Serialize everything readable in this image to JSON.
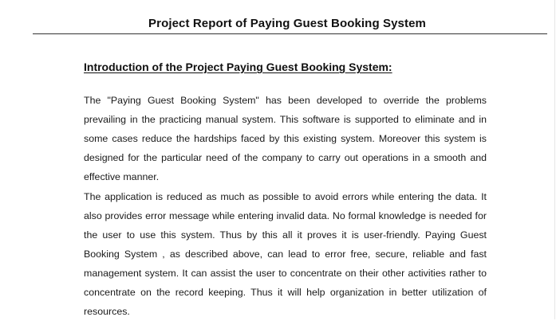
{
  "document": {
    "title": "Project Report of Paying Guest Booking System",
    "section_heading": "Introduction of the Project Paying Guest Booking System:",
    "paragraphs": [
      "The \"Paying Guest Booking System\" has been developed to override the problems prevailing in the practicing manual system. This software is supported to eliminate and in some cases reduce the hardships faced by this existing system. Moreover this system is designed for the particular need of the company to carry out operations in a smooth and effective manner.",
      "The application is reduced as much as possible to avoid errors while entering the data. It also provides error message while entering invalid data. No formal knowledge is needed for the user to use this system. Thus by this all it proves it is user-friendly. Paying Guest Booking System , as described above, can lead to error free, secure, reliable and fast management system. It can assist the user to concentrate on their other activities rather to concentrate on the record keeping. Thus it will help organization in better utilization of resources."
    ]
  }
}
